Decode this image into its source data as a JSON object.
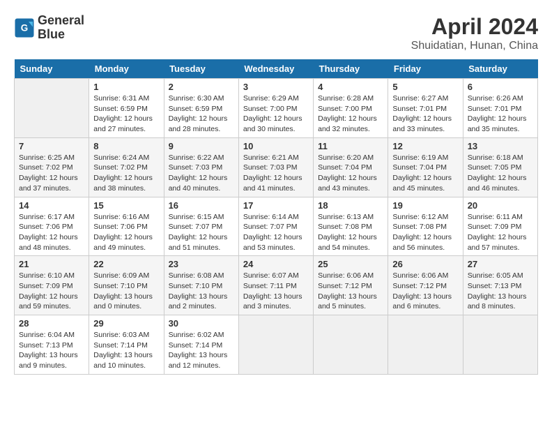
{
  "logo": {
    "line1": "General",
    "line2": "Blue"
  },
  "title": "April 2024",
  "subtitle": "Shuidatian, Hunan, China",
  "days_of_week": [
    "Sunday",
    "Monday",
    "Tuesday",
    "Wednesday",
    "Thursday",
    "Friday",
    "Saturday"
  ],
  "weeks": [
    [
      {
        "day": "",
        "empty": true
      },
      {
        "day": "1",
        "sunrise": "6:31 AM",
        "sunset": "6:59 PM",
        "daylight": "12 hours and 27 minutes."
      },
      {
        "day": "2",
        "sunrise": "6:30 AM",
        "sunset": "6:59 PM",
        "daylight": "12 hours and 28 minutes."
      },
      {
        "day": "3",
        "sunrise": "6:29 AM",
        "sunset": "7:00 PM",
        "daylight": "12 hours and 30 minutes."
      },
      {
        "day": "4",
        "sunrise": "6:28 AM",
        "sunset": "7:00 PM",
        "daylight": "12 hours and 32 minutes."
      },
      {
        "day": "5",
        "sunrise": "6:27 AM",
        "sunset": "7:01 PM",
        "daylight": "12 hours and 33 minutes."
      },
      {
        "day": "6",
        "sunrise": "6:26 AM",
        "sunset": "7:01 PM",
        "daylight": "12 hours and 35 minutes."
      }
    ],
    [
      {
        "day": "7",
        "sunrise": "6:25 AM",
        "sunset": "7:02 PM",
        "daylight": "12 hours and 37 minutes."
      },
      {
        "day": "8",
        "sunrise": "6:24 AM",
        "sunset": "7:02 PM",
        "daylight": "12 hours and 38 minutes."
      },
      {
        "day": "9",
        "sunrise": "6:22 AM",
        "sunset": "7:03 PM",
        "daylight": "12 hours and 40 minutes."
      },
      {
        "day": "10",
        "sunrise": "6:21 AM",
        "sunset": "7:03 PM",
        "daylight": "12 hours and 41 minutes."
      },
      {
        "day": "11",
        "sunrise": "6:20 AM",
        "sunset": "7:04 PM",
        "daylight": "12 hours and 43 minutes."
      },
      {
        "day": "12",
        "sunrise": "6:19 AM",
        "sunset": "7:04 PM",
        "daylight": "12 hours and 45 minutes."
      },
      {
        "day": "13",
        "sunrise": "6:18 AM",
        "sunset": "7:05 PM",
        "daylight": "12 hours and 46 minutes."
      }
    ],
    [
      {
        "day": "14",
        "sunrise": "6:17 AM",
        "sunset": "7:06 PM",
        "daylight": "12 hours and 48 minutes."
      },
      {
        "day": "15",
        "sunrise": "6:16 AM",
        "sunset": "7:06 PM",
        "daylight": "12 hours and 49 minutes."
      },
      {
        "day": "16",
        "sunrise": "6:15 AM",
        "sunset": "7:07 PM",
        "daylight": "12 hours and 51 minutes."
      },
      {
        "day": "17",
        "sunrise": "6:14 AM",
        "sunset": "7:07 PM",
        "daylight": "12 hours and 53 minutes."
      },
      {
        "day": "18",
        "sunrise": "6:13 AM",
        "sunset": "7:08 PM",
        "daylight": "12 hours and 54 minutes."
      },
      {
        "day": "19",
        "sunrise": "6:12 AM",
        "sunset": "7:08 PM",
        "daylight": "12 hours and 56 minutes."
      },
      {
        "day": "20",
        "sunrise": "6:11 AM",
        "sunset": "7:09 PM",
        "daylight": "12 hours and 57 minutes."
      }
    ],
    [
      {
        "day": "21",
        "sunrise": "6:10 AM",
        "sunset": "7:09 PM",
        "daylight": "12 hours and 59 minutes."
      },
      {
        "day": "22",
        "sunrise": "6:09 AM",
        "sunset": "7:10 PM",
        "daylight": "13 hours and 0 minutes."
      },
      {
        "day": "23",
        "sunrise": "6:08 AM",
        "sunset": "7:10 PM",
        "daylight": "13 hours and 2 minutes."
      },
      {
        "day": "24",
        "sunrise": "6:07 AM",
        "sunset": "7:11 PM",
        "daylight": "13 hours and 3 minutes."
      },
      {
        "day": "25",
        "sunrise": "6:06 AM",
        "sunset": "7:12 PM",
        "daylight": "13 hours and 5 minutes."
      },
      {
        "day": "26",
        "sunrise": "6:06 AM",
        "sunset": "7:12 PM",
        "daylight": "13 hours and 6 minutes."
      },
      {
        "day": "27",
        "sunrise": "6:05 AM",
        "sunset": "7:13 PM",
        "daylight": "13 hours and 8 minutes."
      }
    ],
    [
      {
        "day": "28",
        "sunrise": "6:04 AM",
        "sunset": "7:13 PM",
        "daylight": "13 hours and 9 minutes."
      },
      {
        "day": "29",
        "sunrise": "6:03 AM",
        "sunset": "7:14 PM",
        "daylight": "13 hours and 10 minutes."
      },
      {
        "day": "30",
        "sunrise": "6:02 AM",
        "sunset": "7:14 PM",
        "daylight": "13 hours and 12 minutes."
      },
      {
        "day": "",
        "empty": true
      },
      {
        "day": "",
        "empty": true
      },
      {
        "day": "",
        "empty": true
      },
      {
        "day": "",
        "empty": true
      }
    ]
  ]
}
